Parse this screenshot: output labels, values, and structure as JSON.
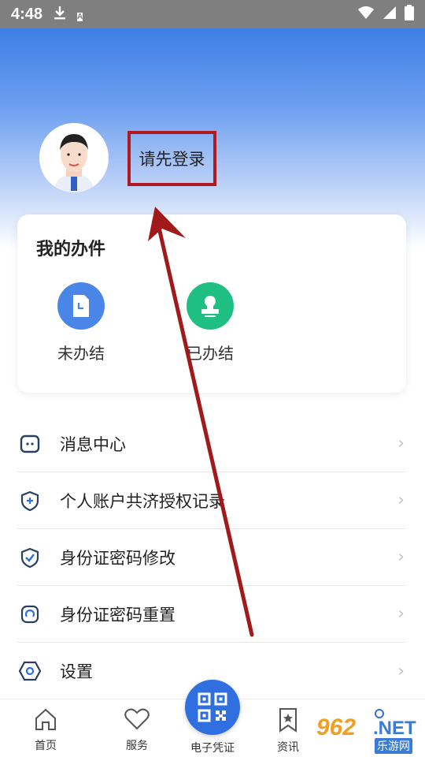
{
  "status_bar": {
    "time": "4:48",
    "download_icon": "download-icon",
    "a_icon_text": "A"
  },
  "profile": {
    "login_prompt": "请先登录"
  },
  "work_card": {
    "title": "我的办件",
    "items": [
      {
        "label": "未办结",
        "icon": "document-clock-icon",
        "color": "#4a86e8"
      },
      {
        "label": "已办结",
        "icon": "stamp-icon",
        "color": "#1fbf84"
      }
    ]
  },
  "menu": [
    {
      "label": "消息中心",
      "icon": "message-icon"
    },
    {
      "label": "个人账户共济授权记录",
      "icon": "shield-plus-icon"
    },
    {
      "label": "身份证密码修改",
      "icon": "shield-check-icon"
    },
    {
      "label": "身份证密码重置",
      "icon": "reset-icon"
    },
    {
      "label": "设置",
      "icon": "settings-hex-icon"
    }
  ],
  "bottom_nav": {
    "home": "首页",
    "service": "服务",
    "ecard": "电子凭证",
    "news": "资讯"
  },
  "watermark": {
    "num": "962",
    "net": ".NET",
    "cn": "乐游网"
  },
  "colors": {
    "accent": "#2f6fe0",
    "highlight_box": "#b0191e",
    "arrow": "#a01a1a"
  }
}
